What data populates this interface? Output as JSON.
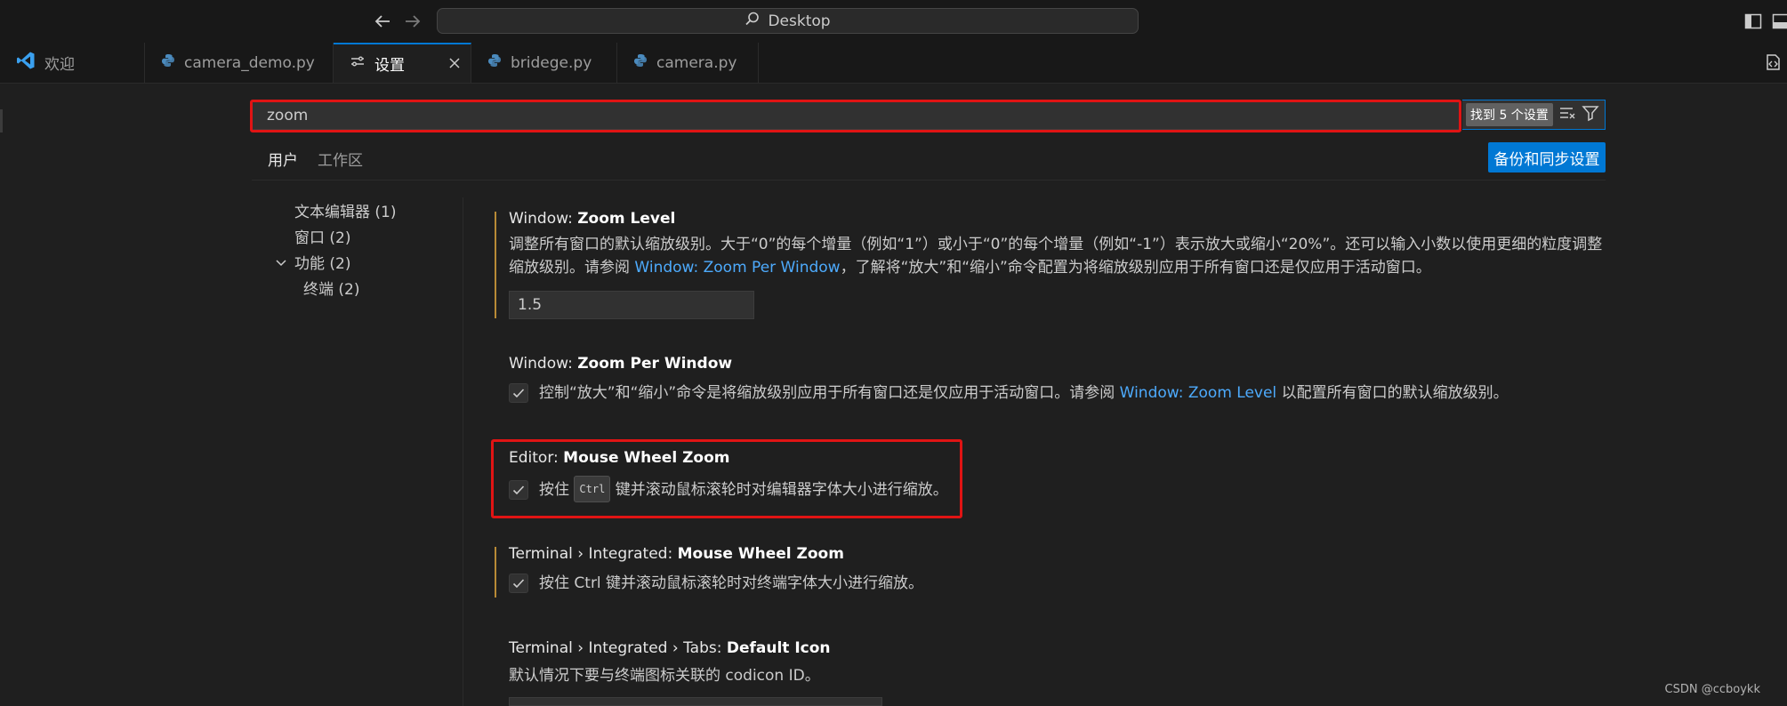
{
  "titlebar": {
    "title": "Desktop"
  },
  "tabs": [
    {
      "label": "欢迎",
      "icon": "vscode-logo-icon"
    },
    {
      "label": "camera_demo.py",
      "icon": "python-file-icon"
    },
    {
      "label": "设置",
      "icon": "settings-editor-icon",
      "active": true
    },
    {
      "label": "bridege.py",
      "icon": "python-file-icon"
    },
    {
      "label": "camera.py",
      "icon": "python-file-icon"
    }
  ],
  "search": {
    "value": "zoom",
    "placeholder": "",
    "result": "找到 5 个设置"
  },
  "scope": {
    "user": "用户",
    "workspace": "工作区",
    "sync_button": "备份和同步设置"
  },
  "toc": [
    {
      "label": "文本编辑器 (1)"
    },
    {
      "label": "窗口 (2)"
    },
    {
      "label": "功能 (2)",
      "expanded": true
    },
    {
      "label": "终端 (2)"
    }
  ],
  "settings": {
    "zoom_level": {
      "category": "Window: ",
      "name": "Zoom Level",
      "desc_1": "调整所有窗口的默认缩放级别。大于“0”的每个增量（例如“1”）或小于“0”的每个增量（例如“-1”）表示放大或缩小“20%”。还可以输入小数以使用更细的粒度调整",
      "desc_2_pre": "缩放级别。请参阅 ",
      "desc_2_link": "Window: Zoom Per Window",
      "desc_2_post": "，了解将“放大”和“缩小”命令配置为将缩放级别应用于所有窗口还是仅应用于活动窗口。",
      "value": "1.5"
    },
    "zoom_per_window": {
      "category": "Window: ",
      "name": "Zoom Per Window",
      "desc_pre": "控制“放大”和“缩小”命令是将缩放级别应用于所有窗口还是仅应用于活动窗口。请参阅 ",
      "desc_link": "Window: Zoom Level",
      "desc_post": " 以配置所有窗口的默认缩放级别。",
      "checked": true
    },
    "editor_mouse_wheel_zoom": {
      "category": "Editor: ",
      "name": "Mouse Wheel Zoom",
      "desc_pre": "按住 ",
      "desc_key": "Ctrl",
      "desc_post": " 键并滚动鼠标滚轮时对编辑器字体大小进行缩放。",
      "checked": true
    },
    "terminal_mouse_wheel_zoom": {
      "category": "Terminal › Integrated: ",
      "name": "Mouse Wheel Zoom",
      "desc": "按住 Ctrl 键并滚动鼠标滚轮时对终端字体大小进行缩放。",
      "checked": true
    },
    "terminal_default_icon": {
      "category": "Terminal › Integrated › Tabs: ",
      "name": "Default Icon",
      "desc": "默认情况下要与终端图标关联的 codicon ID。"
    }
  },
  "watermark": "CSDN @ccboykk",
  "colors": {
    "accent": "#0078d4",
    "link": "#4daafc",
    "highlight_box": "#e01414",
    "modified_bar": "#b88a36"
  }
}
